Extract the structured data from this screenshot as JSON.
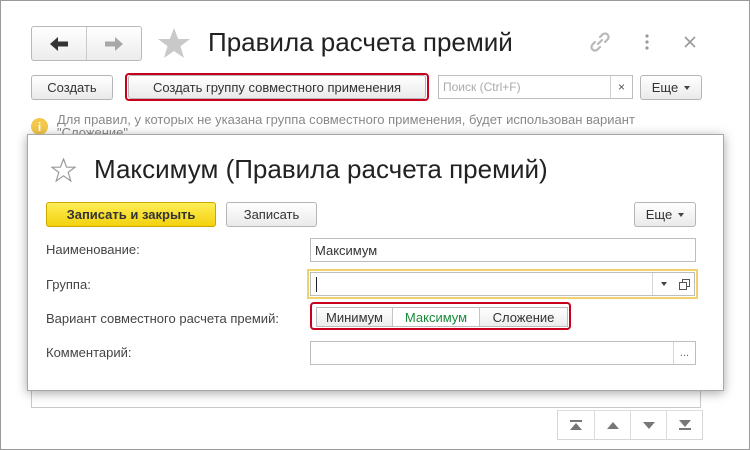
{
  "window": {
    "title": "Правила расчета премий",
    "nav": {
      "back_icon": "arrow-left-icon",
      "forward_icon": "arrow-right-icon"
    },
    "star_icon": "star-icon",
    "link_icon": "link-icon",
    "menu_icon": "more-vertical-icon",
    "close_icon": "close-icon"
  },
  "toolbar": {
    "create_label": "Создать",
    "create_group_label": "Создать группу совместного применения",
    "search_placeholder": "Поиск (Ctrl+F)",
    "search_clear": "×",
    "more_label": "Еще"
  },
  "info": {
    "line1": "Для правил, у которых не указана группа совместного применения, будет использован вариант",
    "line2": "\"Сложение\""
  },
  "scroll": [
    "scroll-top-icon",
    "scroll-up-icon",
    "scroll-down-icon",
    "scroll-bottom-icon"
  ],
  "modal": {
    "title": "Максимум (Правила расчета премий)",
    "save_close_label": "Записать и закрыть",
    "save_label": "Записать",
    "more_label": "Еще",
    "name_label": "Наименование:",
    "name_value": "Максимум",
    "group_label": "Группа:",
    "group_value": "",
    "variant_label": "Вариант совместного расчета премий:",
    "variants": [
      "Минимум",
      "Максимум",
      "Сложение"
    ],
    "variant_selected": "Максимум",
    "comment_label": "Комментарий:",
    "comment_value": "",
    "comment_button": "..."
  },
  "colors": {
    "highlight_border": "#c8001e",
    "primary_button": "#f7dc2f",
    "active_variant": "#1a8a3a",
    "info_icon": "#f2c94c"
  }
}
